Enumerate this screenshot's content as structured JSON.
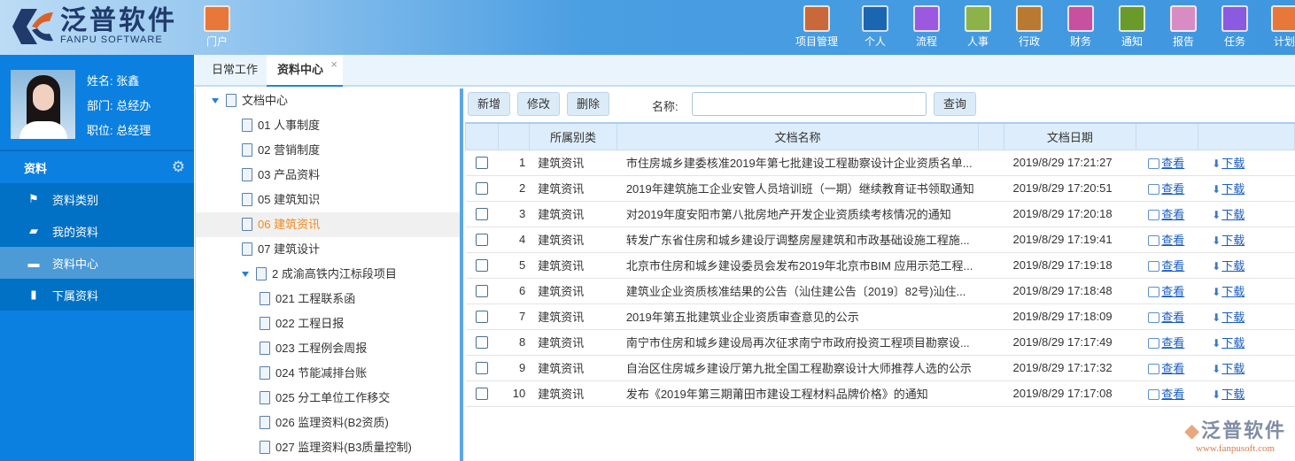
{
  "brand": {
    "name_cn": "泛普软件",
    "name_en": "FANPU SOFTWARE",
    "colors": {
      "navy": "#1f3a6b",
      "orange": "#d9622a"
    }
  },
  "top_nav": [
    {
      "label": "门户",
      "icon": "home-icon",
      "color": "#e8773a"
    },
    {
      "label": "项目管理",
      "icon": "grid-icon",
      "color": "#c9683a"
    },
    {
      "label": "个人",
      "icon": "user-icon",
      "color": "#1a66b0"
    },
    {
      "label": "流程",
      "icon": "flowchart-icon",
      "color": "#9b59e0"
    },
    {
      "label": "人事",
      "icon": "person-list-icon",
      "color": "#8bb34a"
    },
    {
      "label": "行政",
      "icon": "layers-icon",
      "color": "#b87a30"
    },
    {
      "label": "财务",
      "icon": "yen-icon",
      "color": "#c7509f"
    },
    {
      "label": "通知",
      "icon": "speaker-icon",
      "color": "#6a9a2a"
    },
    {
      "label": "报告",
      "icon": "report-icon",
      "color": "#d88cc4"
    },
    {
      "label": "任务",
      "icon": "task-icon",
      "color": "#8a5ae0"
    },
    {
      "label": "计划",
      "icon": "sliders-icon",
      "color": "#e8773a"
    }
  ],
  "profile": {
    "name": "姓名: 张鑫",
    "dept": "部门: 总经办",
    "position": "职位: 总经理"
  },
  "sidebar": {
    "section": "资料",
    "items": [
      {
        "label": "资料类别",
        "icon": "flag-icon"
      },
      {
        "label": "我的资料",
        "icon": "briefcase-icon"
      },
      {
        "label": "资料中心",
        "icon": "folder-icon",
        "active": true
      },
      {
        "label": "下属资料",
        "icon": "file-icon"
      }
    ]
  },
  "tabs": [
    {
      "label": "日常工作"
    },
    {
      "label": "资料中心",
      "active": true
    }
  ],
  "tree": [
    {
      "label": "文档中心",
      "level": 0,
      "expanded": true
    },
    {
      "label": "01 人事制度",
      "level": 1
    },
    {
      "label": "02 营销制度",
      "level": 1
    },
    {
      "label": "03 产品资料",
      "level": 1
    },
    {
      "label": "05 建筑知识",
      "level": 1
    },
    {
      "label": "06 建筑资讯",
      "level": 1,
      "selected": true
    },
    {
      "label": "07 建筑设计",
      "level": 1
    },
    {
      "label": "2 成渝高铁内江标段项目",
      "level": 1,
      "expanded": true
    },
    {
      "label": "021 工程联系函",
      "level": 2
    },
    {
      "label": "022 工程日报",
      "level": 2
    },
    {
      "label": "023 工程例会周报",
      "level": 2
    },
    {
      "label": "024 节能减排台账",
      "level": 2
    },
    {
      "label": "025 分工单位工作移交",
      "level": 2
    },
    {
      "label": "026 监理资料(B2资质)",
      "level": 2
    },
    {
      "label": "027 监理资料(B3质量控制)",
      "level": 2
    }
  ],
  "toolbar": {
    "add": "新增",
    "edit": "修改",
    "delete": "删除",
    "name_label": "名称:",
    "name_value": "",
    "search": "查询"
  },
  "table": {
    "headers": [
      "",
      "",
      "所属别类",
      "文档名称",
      "",
      "文档日期",
      "",
      ""
    ],
    "view_label": "查看",
    "download_label": "下载",
    "rows": [
      {
        "no": "1",
        "cat": "建筑资讯",
        "name": "市住房城乡建委核准2019年第七批建设工程勘察设计企业资质名单...",
        "date": "2019/8/29 17:21:27"
      },
      {
        "no": "2",
        "cat": "建筑资讯",
        "name": "2019年建筑施工企业安管人员培训班（一期）继续教育证书领取通知",
        "date": "2019/8/29 17:20:51"
      },
      {
        "no": "3",
        "cat": "建筑资讯",
        "name": "对2019年度安阳市第八批房地产开发企业资质续考核情况的通知",
        "date": "2019/8/29 17:20:18"
      },
      {
        "no": "4",
        "cat": "建筑资讯",
        "name": "转发广东省住房和城乡建设厅调整房屋建筑和市政基础设施工程施...",
        "date": "2019/8/29 17:19:41"
      },
      {
        "no": "5",
        "cat": "建筑资讯",
        "name": "北京市住房和城乡建设委员会发布2019年北京市BIM 应用示范工程...",
        "date": "2019/8/29 17:19:18"
      },
      {
        "no": "6",
        "cat": "建筑资讯",
        "name": "建筑业企业资质核准结果的公告（汕住建公告〔2019〕82号)汕住...",
        "date": "2019/8/29 17:18:48"
      },
      {
        "no": "7",
        "cat": "建筑资讯",
        "name": "2019年第五批建筑业企业资质审查意见的公示",
        "date": "2019/8/29 17:18:09"
      },
      {
        "no": "8",
        "cat": "建筑资讯",
        "name": "南宁市住房和城乡建设局再次征求南宁市政府投资工程项目勘察设...",
        "date": "2019/8/29 17:17:49"
      },
      {
        "no": "9",
        "cat": "建筑资讯",
        "name": "自治区住房城乡建设厅第九批全国工程勘察设计大师推荐人选的公示",
        "date": "2019/8/29 17:17:32"
      },
      {
        "no": "10",
        "cat": "建筑资讯",
        "name": "发布《2019年第三期莆田市建设工程材料品牌价格》的通知",
        "date": "2019/8/29 17:17:08"
      }
    ]
  },
  "watermark": {
    "name": "泛普软件",
    "url": "www.fanpusoft.com"
  }
}
